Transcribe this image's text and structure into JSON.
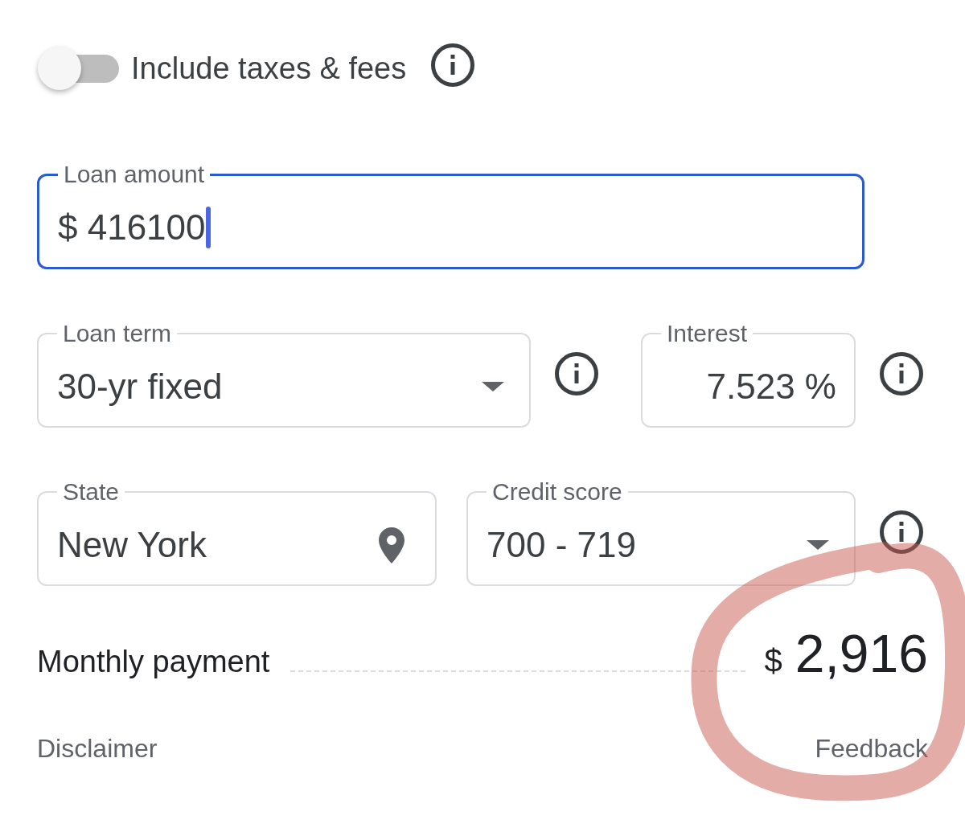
{
  "taxes_toggle": {
    "label": "Include taxes & fees",
    "on": false,
    "info": true
  },
  "rows": [
    {
      "fields": [
        {
          "kind": "amount",
          "label": "Loan amount",
          "value": "$ 416100",
          "focused": true,
          "info": false
        }
      ]
    },
    {
      "fields": [
        {
          "kind": "dropdown",
          "label": "Loan term",
          "value": "30-yr fixed",
          "focused": false,
          "info": true
        },
        {
          "kind": "rate",
          "label": "Interest",
          "value": "7.523 %",
          "focused": false,
          "info": true
        }
      ]
    },
    {
      "fields": [
        {
          "kind": "location",
          "label": "State",
          "value": "New York",
          "focused": false,
          "info": false
        },
        {
          "kind": "dropdown",
          "label": "Credit score",
          "value": "700 - 719",
          "focused": false,
          "info": true
        }
      ]
    }
  ],
  "payment": {
    "label": "Monthly payment",
    "currency": "$",
    "amount": "2,916"
  },
  "footer": {
    "links": [
      "Disclaimer",
      "Feedback"
    ]
  },
  "annotation": {
    "kind": "circle"
  }
}
